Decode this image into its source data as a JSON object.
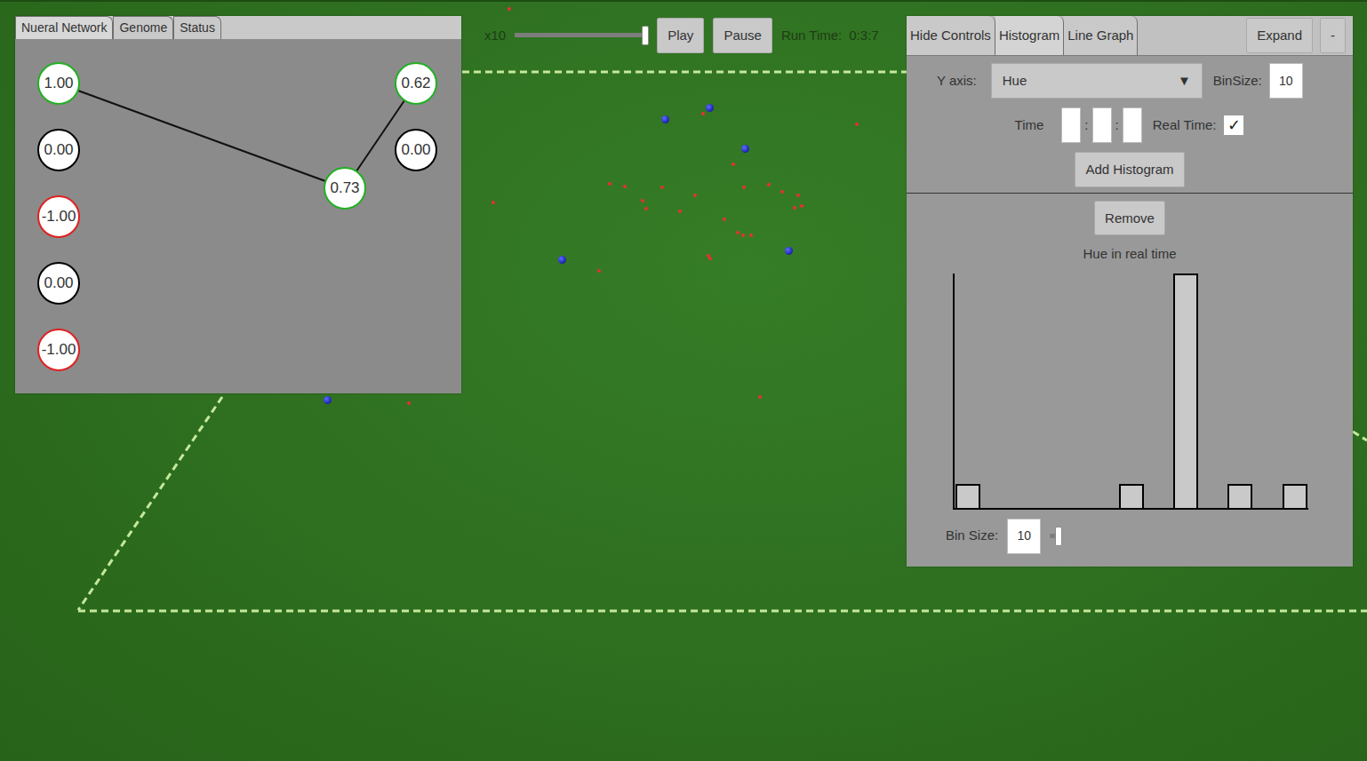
{
  "network_panel": {
    "tabs": [
      {
        "label": "Nueral Network",
        "selected": true
      },
      {
        "label": "Genome",
        "selected": false
      },
      {
        "label": "Status",
        "selected": false
      }
    ],
    "inputs": [
      {
        "value": "1.00",
        "color": "#22b022"
      },
      {
        "value": "0.00",
        "color": "#000000"
      },
      {
        "value": "-1.00",
        "color": "#e02020"
      },
      {
        "value": "0.00",
        "color": "#000000"
      },
      {
        "value": "-1.00",
        "color": "#e02020"
      }
    ],
    "hidden": [
      {
        "value": "0.73",
        "color": "#22b022"
      }
    ],
    "outputs": [
      {
        "value": "0.62",
        "color": "#22b022"
      },
      {
        "value": "0.00",
        "color": "#000000"
      }
    ],
    "connections": [
      {
        "from": "inputs.0",
        "to": "hidden.0"
      },
      {
        "from": "hidden.0",
        "to": "outputs.0"
      }
    ]
  },
  "playback": {
    "speed_label": "x10",
    "speed_level": 0.98,
    "buttons": [
      "Play",
      "Pause"
    ],
    "run_time_label": "Run Time:",
    "run_time": "0:3:7"
  },
  "graph_panel": {
    "tabs": [
      {
        "label": "Hide Controls",
        "selected": false
      },
      {
        "label": "Histogram",
        "selected": true
      },
      {
        "label": "Line Graph",
        "selected": false
      }
    ],
    "expand": "Expand",
    "minimize": "-",
    "y_axis_label": "Y axis:",
    "y_axis_value": "Hue",
    "dropdown_arrow": "▼",
    "bin_size_label": "BinSize:",
    "bin_size_value": "10",
    "time_label": "Time",
    "time_fields": [
      "",
      "",
      ""
    ],
    "time_separators": [
      ":",
      ":"
    ],
    "real_time_label": "Real Time:",
    "real_time_checked": true,
    "check_mark": "✓",
    "add_button": "Add Histogram",
    "histogram": {
      "remove_button": "Remove",
      "title": "Hue in real time",
      "values": [
        1,
        0,
        0,
        0,
        0,
        0,
        1,
        0,
        10,
        0,
        1,
        0,
        1
      ],
      "bin_size_label": "Bin Size:",
      "bin_size_value": "10",
      "bin_size_level": 0.03
    }
  },
  "world": {
    "entities": [
      {
        "kind": "food"
      },
      {
        "kind": "food"
      },
      {
        "kind": "food"
      },
      {
        "kind": "food"
      },
      {
        "kind": "food"
      },
      {
        "kind": "food"
      },
      {
        "kind": "food"
      },
      {
        "kind": "food"
      },
      {
        "kind": "food"
      },
      {
        "kind": "food"
      },
      {
        "kind": "food"
      },
      {
        "kind": "food"
      },
      {
        "kind": "food"
      },
      {
        "kind": "food"
      },
      {
        "kind": "food"
      },
      {
        "kind": "food"
      },
      {
        "kind": "food"
      },
      {
        "kind": "food"
      },
      {
        "kind": "food"
      },
      {
        "kind": "food"
      },
      {
        "kind": "food"
      },
      {
        "kind": "food"
      },
      {
        "kind": "food"
      },
      {
        "kind": "food"
      },
      {
        "kind": "food"
      },
      {
        "kind": "food"
      },
      {
        "kind": "food"
      },
      {
        "kind": "creature"
      },
      {
        "kind": "creature"
      },
      {
        "kind": "creature"
      },
      {
        "kind": "creature"
      },
      {
        "kind": "creature"
      },
      {
        "kind": "creature"
      }
    ]
  }
}
